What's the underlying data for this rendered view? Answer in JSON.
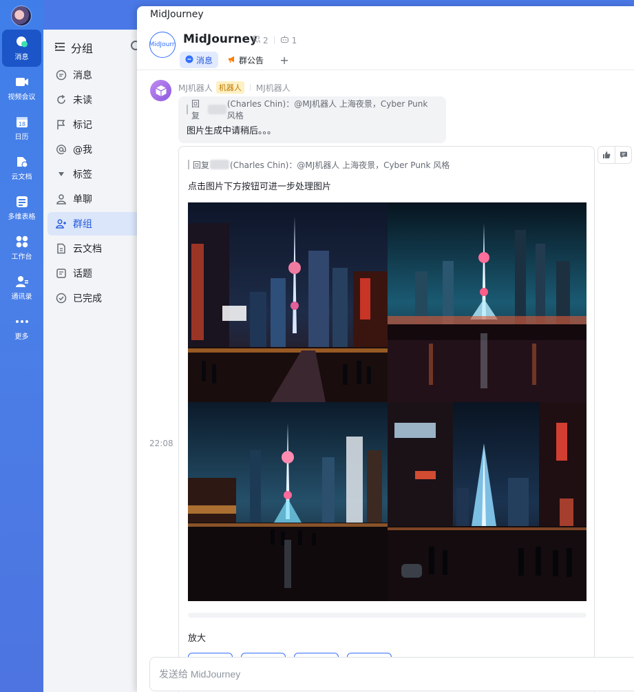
{
  "rail": {
    "items": [
      {
        "label": "消息",
        "icon": "chat-bubble-icon"
      },
      {
        "label": "视频会议",
        "icon": "video-icon"
      },
      {
        "label": "日历",
        "icon": "calendar-icon",
        "badge": "18"
      },
      {
        "label": "云文档",
        "icon": "cloud-doc-icon"
      },
      {
        "label": "多维表格",
        "icon": "table-icon"
      },
      {
        "label": "工作台",
        "icon": "workspace-icon"
      },
      {
        "label": "通讯录",
        "icon": "contacts-icon"
      },
      {
        "label": "更多",
        "icon": "more-icon"
      }
    ]
  },
  "sidebar": {
    "title": "分组",
    "items": [
      {
        "label": "消息"
      },
      {
        "label": "未读"
      },
      {
        "label": "标记"
      },
      {
        "label": "@我"
      },
      {
        "label": "标签"
      },
      {
        "label": "单聊"
      },
      {
        "label": "群组"
      },
      {
        "label": "云文档"
      },
      {
        "label": "话题"
      },
      {
        "label": "已完成"
      }
    ]
  },
  "window": {
    "title": "MidJourney"
  },
  "chat": {
    "avatar_text": "MidJourn",
    "name": "MidJourney",
    "member_count": "2",
    "bot_count": "1",
    "tabs": [
      {
        "label": "消息"
      },
      {
        "label": "群公告"
      }
    ],
    "add_tab": "+"
  },
  "messages": {
    "sender_name": "MJ机器人",
    "bot_tag": "机器人",
    "sender_group": "MJ机器人",
    "msg1": {
      "quote_prefix": "回复",
      "quote_rest": "(Charles Chin)：@MJ机器人 上海夜景，Cyber Punk 风格",
      "text": "图片生成中请稍后。。。"
    },
    "msg2": {
      "quote_prefix": "回复",
      "quote_rest": "(Charles Chin)：@MJ机器人 上海夜景，Cyber Punk 风格",
      "text": "点击图片下方按钮可进一步处理图片",
      "zoom_label": "放大",
      "timestamp": "22:08"
    }
  },
  "composer": {
    "placeholder": "发送给 MidJourney"
  },
  "colors": {
    "accent": "#3370ff",
    "rail": "#4a80e8",
    "active_rail": "#1b55c7",
    "sidebar": "#f2f4f7"
  }
}
